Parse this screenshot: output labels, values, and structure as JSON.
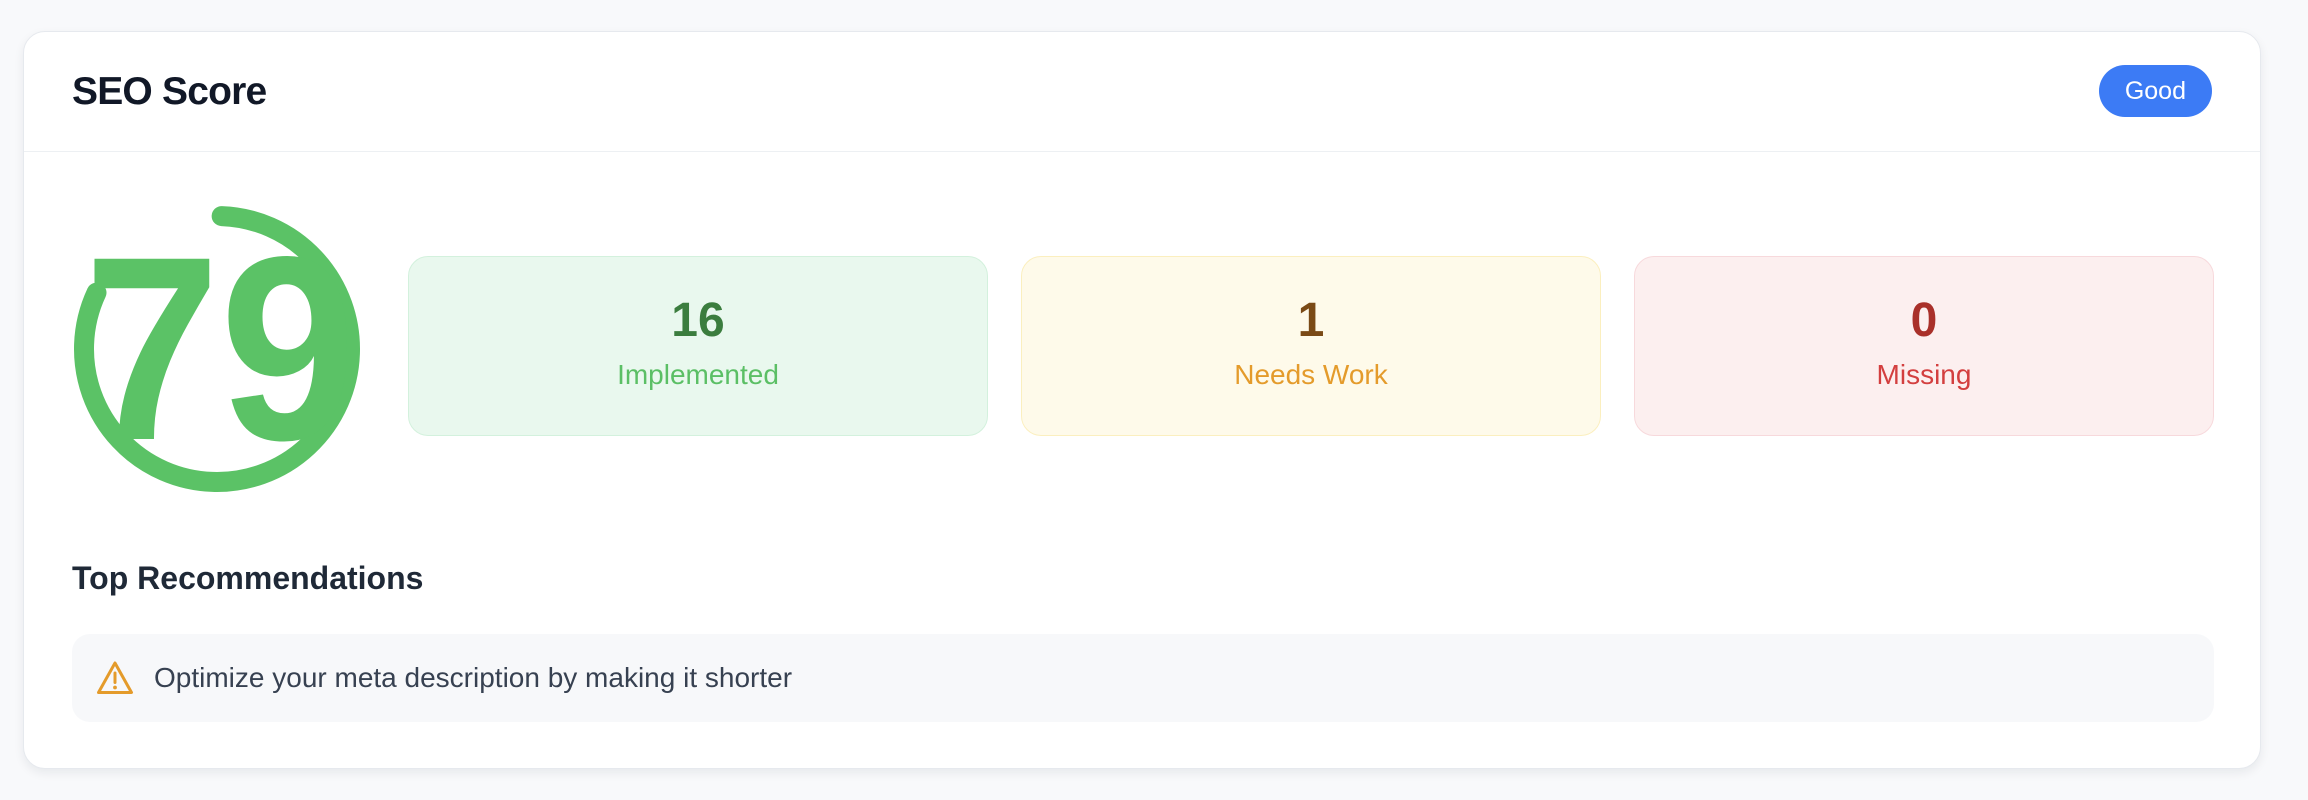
{
  "header": {
    "title": "SEO Score",
    "badge": "Good"
  },
  "score": {
    "value": "79",
    "color": "#5bc266"
  },
  "stats": {
    "implemented": {
      "value": "16",
      "label": "Implemented"
    },
    "needs_work": {
      "value": "1",
      "label": "Needs Work"
    },
    "missing": {
      "value": "0",
      "label": "Missing"
    }
  },
  "recommendations": {
    "title": "Top Recommendations",
    "items": [
      {
        "icon": "warning-triangle-icon",
        "text": "Optimize your meta description by making it shorter"
      }
    ]
  },
  "colors": {
    "accent": "#3c7bf5",
    "success": "#5bc266",
    "warning": "#e49b2b",
    "danger": "#d33f3f"
  }
}
